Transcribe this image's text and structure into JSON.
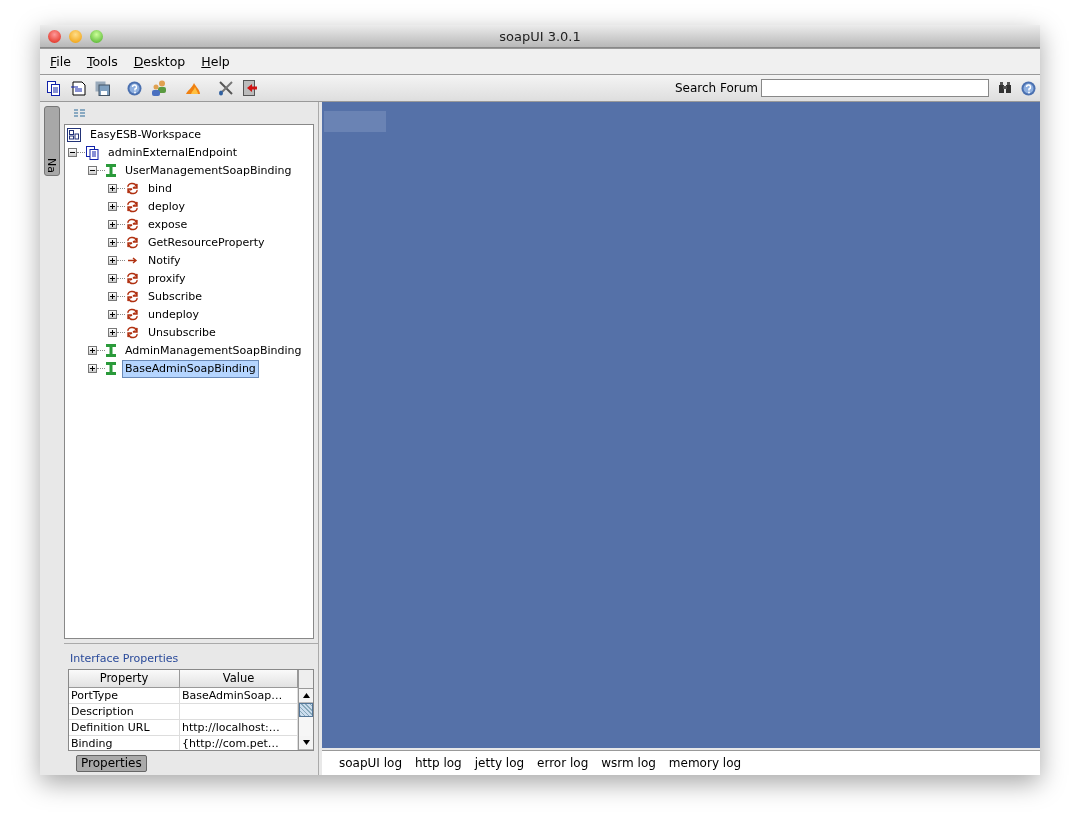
{
  "window": {
    "title": "soapUI 3.0.1"
  },
  "menu": [
    "File",
    "Tools",
    "Desktop",
    "Help"
  ],
  "search": {
    "label": "Search Forum"
  },
  "navigator_tab": {
    "label": "Na"
  },
  "tree": [
    {
      "kind": "workspace",
      "label": "EasyESB-Workspace",
      "selected": false,
      "children": [
        {
          "kind": "project",
          "label": "adminExternalEndpoint",
          "selected": false,
          "expanded": true,
          "children": [
            {
              "kind": "interface",
              "label": "UserManagementSoapBinding",
              "selected": false,
              "expanded": true,
              "children": [
                {
                  "kind": "operation",
                  "label": "bind",
                  "selected": false,
                  "expanded": false
                },
                {
                  "kind": "operation",
                  "label": "deploy",
                  "selected": false,
                  "expanded": false
                },
                {
                  "kind": "operation",
                  "label": "expose",
                  "selected": false,
                  "expanded": false
                },
                {
                  "kind": "operation",
                  "label": "GetResourceProperty",
                  "selected": false,
                  "expanded": false
                },
                {
                  "kind": "notification",
                  "label": "Notify",
                  "selected": false,
                  "expanded": false
                },
                {
                  "kind": "operation",
                  "label": "proxify",
                  "selected": false,
                  "expanded": false
                },
                {
                  "kind": "operation",
                  "label": "Subscribe",
                  "selected": false,
                  "expanded": false
                },
                {
                  "kind": "operation",
                  "label": "undeploy",
                  "selected": false,
                  "expanded": false
                },
                {
                  "kind": "operation",
                  "label": "Unsubscribe",
                  "selected": false,
                  "expanded": false
                }
              ]
            },
            {
              "kind": "interface",
              "label": "AdminManagementSoapBinding",
              "selected": false,
              "expanded": false
            },
            {
              "kind": "interface",
              "label": "BaseAdminSoapBinding",
              "selected": true,
              "expanded": false
            }
          ]
        }
      ]
    }
  ],
  "properties": {
    "title": "Interface Properties",
    "columns": [
      "Property",
      "Value"
    ],
    "rows": [
      [
        "PortType",
        "BaseAdminSoap…"
      ],
      [
        "Description",
        ""
      ],
      [
        "Definition URL",
        "http://localhost:…"
      ],
      [
        "Binding",
        "{http://com.pet…"
      ]
    ],
    "tab": {
      "label": "Properties",
      "selected": true
    }
  },
  "log_tabs": [
    "soapUI log",
    "http log",
    "jetty log",
    "error log",
    "wsrm log",
    "memory log"
  ]
}
